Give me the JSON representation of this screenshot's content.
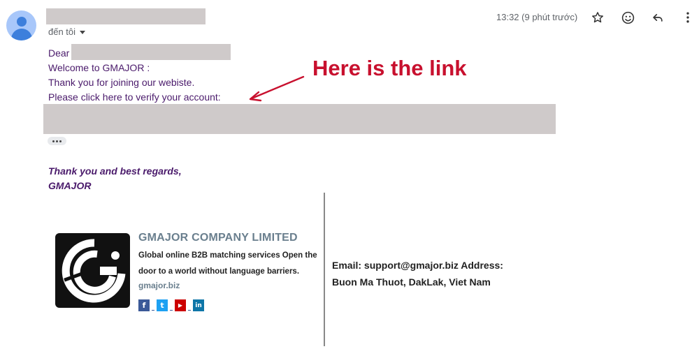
{
  "header": {
    "recipient_label": "đến tôi",
    "timestamp": "13:32 (9 phút trước)",
    "icons": [
      "star-icon",
      "emoji-icon",
      "reply-icon",
      "more-vert-icon"
    ]
  },
  "message": {
    "greeting": "Dear",
    "line1": "Welcome to GMAJOR :",
    "line2": "Thank you for joining our webiste.",
    "line3": "Please click here to verify your account:",
    "closing1": "Thank you and best regards,",
    "closing2": "GMAJOR"
  },
  "annotation": {
    "text": "Here is the link",
    "color": "#c8102e"
  },
  "signature": {
    "company": "GMAJOR COMPANY LIMITED",
    "tagline": "Global online B2B matching services Open the door to a world without language barriers.",
    "website": "gmajor.biz",
    "socials": [
      {
        "glyph": "f",
        "color": "#3b5998"
      },
      {
        "glyph": "t",
        "color": "#1da1f2"
      },
      {
        "glyph": "▶",
        "color": "#cc0000"
      },
      {
        "glyph": "in",
        "color": "#0e76a8"
      }
    ],
    "contact_line1": "Email: support@gmajor.biz Address:",
    "contact_line2": "Buon Ma Thuot, DakLak, Viet Nam"
  },
  "colors": {
    "body_text": "#4a1a6b",
    "redaction": "#cfcaca",
    "brand_gray": "#6a7f8e"
  }
}
